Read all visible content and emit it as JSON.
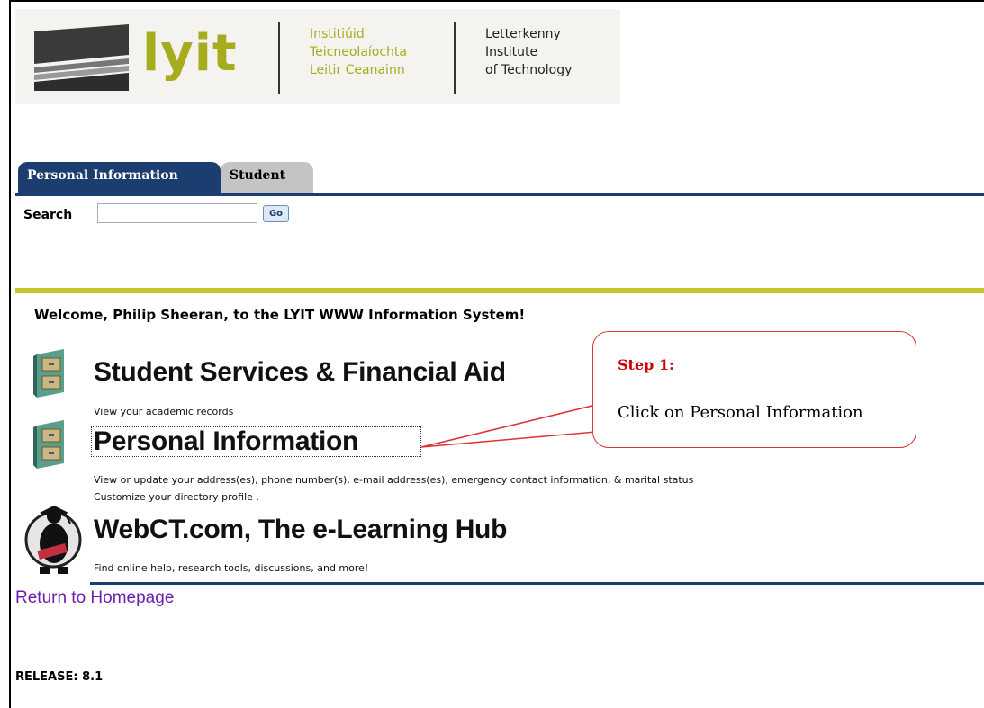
{
  "logo": {
    "wordmark": "lyit",
    "irish_lines": [
      "Institiúid",
      "Teicneolaíochta",
      "Leitir Ceanainn"
    ],
    "english_lines": [
      "Letterkenny",
      "Institute",
      "of Technology"
    ]
  },
  "tabs": [
    {
      "label": "Personal Information",
      "active": true
    },
    {
      "label": "Student",
      "active": false
    }
  ],
  "search": {
    "label": "Search",
    "value": "",
    "go_label": "Go"
  },
  "welcome": "Welcome, Philip Sheeran, to the LYIT WWW Information System!",
  "menu": [
    {
      "title": "Student Services & Financial Aid",
      "desc": "View your academic records",
      "icon": "file-cabinet-icon"
    },
    {
      "title": "Personal Information",
      "desc": "View or update your address(es), phone number(s), e-mail address(es), emergency contact information, & marital status",
      "desc2": "Customize your directory profile .",
      "icon": "file-cabinet-icon"
    },
    {
      "title": "WebCT.com, The e-Learning Hub",
      "desc": "Find online help, research tools, discussions, and more!",
      "icon": "graduate-mascot-icon"
    }
  ],
  "return_link": "Return to Homepage",
  "release": "RELEASE: 8.1",
  "callout": {
    "title": "Step 1:",
    "text": "Click on Personal Information"
  },
  "colors": {
    "navy": "#1b3d6f",
    "olive": "#a7ac1f",
    "callout_red": "#cc0000",
    "link": "#6b1fb0"
  }
}
